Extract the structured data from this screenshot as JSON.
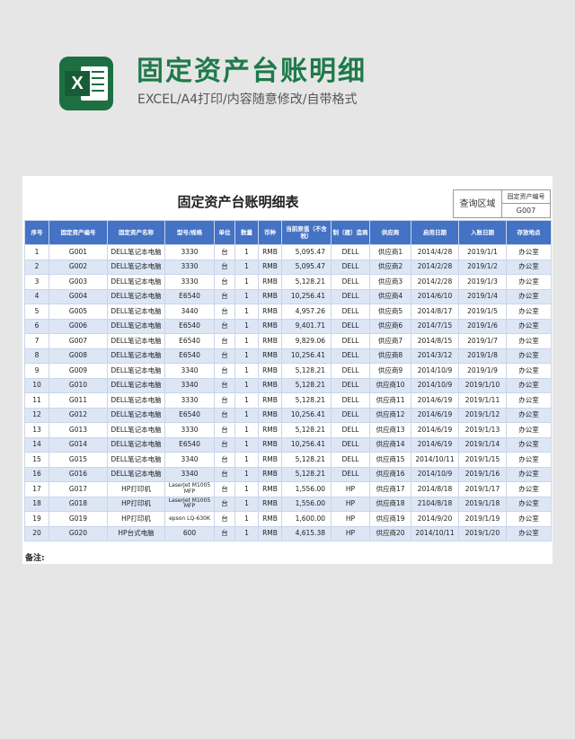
{
  "banner": {
    "icon": "excel-icon",
    "icon_letter": "X",
    "title": "固定资产台账明细",
    "subtitle": "EXCEL/A4打印/内容随意修改/自带格式"
  },
  "sheet": {
    "title": "固定资产台账明细表",
    "query_label": "查询区域",
    "query_key": "固定资产编号",
    "query_value": "G007",
    "remarks_label": "备注:"
  },
  "table": {
    "headers": [
      "序号",
      "固定资产编号",
      "固定资产名称",
      "型号/规格",
      "单位",
      "数量",
      "币种",
      "当前原值（不含税）",
      "制（建）造商",
      "供应商",
      "启用日期",
      "入账日期",
      "存放地点"
    ],
    "rows": [
      [
        "1",
        "G001",
        "DELL笔记本电脑",
        "3330",
        "台",
        "1",
        "RMB",
        "5,095.47",
        "DELL",
        "供应商1",
        "2014/4/28",
        "2019/1/1",
        "办公室"
      ],
      [
        "2",
        "G002",
        "DELL笔记本电脑",
        "3330",
        "台",
        "1",
        "RMB",
        "5,095.47",
        "DELL",
        "供应商2",
        "2014/2/28",
        "2019/1/2",
        "办公室"
      ],
      [
        "3",
        "G003",
        "DELL笔记本电脑",
        "3330",
        "台",
        "1",
        "RMB",
        "5,128.21",
        "DELL",
        "供应商3",
        "2014/2/28",
        "2019/1/3",
        "办公室"
      ],
      [
        "4",
        "G004",
        "DELL笔记本电脑",
        "E6540",
        "台",
        "1",
        "RMB",
        "10,256.41",
        "DELL",
        "供应商4",
        "2014/6/10",
        "2019/1/4",
        "办公室"
      ],
      [
        "5",
        "G005",
        "DELL笔记本电脑",
        "3440",
        "台",
        "1",
        "RMB",
        "4,957.26",
        "DELL",
        "供应商5",
        "2014/8/17",
        "2019/1/5",
        "办公室"
      ],
      [
        "6",
        "G006",
        "DELL笔记本电脑",
        "E6540",
        "台",
        "1",
        "RMB",
        "9,401.71",
        "DELL",
        "供应商6",
        "2014/7/15",
        "2019/1/6",
        "办公室"
      ],
      [
        "7",
        "G007",
        "DELL笔记本电脑",
        "E6540",
        "台",
        "1",
        "RMB",
        "9,829.06",
        "DELL",
        "供应商7",
        "2014/8/15",
        "2019/1/7",
        "办公室"
      ],
      [
        "8",
        "G008",
        "DELL笔记本电脑",
        "E6540",
        "台",
        "1",
        "RMB",
        "10,256.41",
        "DELL",
        "供应商8",
        "2014/3/12",
        "2019/1/8",
        "办公室"
      ],
      [
        "9",
        "G009",
        "DELL笔记本电脑",
        "3340",
        "台",
        "1",
        "RMB",
        "5,128.21",
        "DELL",
        "供应商9",
        "2014/10/9",
        "2019/1/9",
        "办公室"
      ],
      [
        "10",
        "G010",
        "DELL笔记本电脑",
        "3340",
        "台",
        "1",
        "RMB",
        "5,128.21",
        "DELL",
        "供应商10",
        "2014/10/9",
        "2019/1/10",
        "办公室"
      ],
      [
        "11",
        "G011",
        "DELL笔记本电脑",
        "3330",
        "台",
        "1",
        "RMB",
        "5,128.21",
        "DELL",
        "供应商11",
        "2014/6/19",
        "2019/1/11",
        "办公室"
      ],
      [
        "12",
        "G012",
        "DELL笔记本电脑",
        "E6540",
        "台",
        "1",
        "RMB",
        "10,256.41",
        "DELL",
        "供应商12",
        "2014/6/19",
        "2019/1/12",
        "办公室"
      ],
      [
        "13",
        "G013",
        "DELL笔记本电脑",
        "3330",
        "台",
        "1",
        "RMB",
        "5,128.21",
        "DELL",
        "供应商13",
        "2014/6/19",
        "2019/1/13",
        "办公室"
      ],
      [
        "14",
        "G014",
        "DELL笔记本电脑",
        "E6540",
        "台",
        "1",
        "RMB",
        "10,256.41",
        "DELL",
        "供应商14",
        "2014/6/19",
        "2019/1/14",
        "办公室"
      ],
      [
        "15",
        "G015",
        "DELL笔记本电脑",
        "3340",
        "台",
        "1",
        "RMB",
        "5,128.21",
        "DELL",
        "供应商15",
        "2014/10/11",
        "2019/1/15",
        "办公室"
      ],
      [
        "16",
        "G016",
        "DELL笔记本电脑",
        "3340",
        "台",
        "1",
        "RMB",
        "5,128.21",
        "DELL",
        "供应商16",
        "2014/10/9",
        "2019/1/16",
        "办公室"
      ],
      [
        "17",
        "G017",
        "HP打印机",
        "LaserJet M1005 MFP",
        "台",
        "1",
        "RMB",
        "1,556.00",
        "HP",
        "供应商17",
        "2014/8/18",
        "2019/1/17",
        "办公室"
      ],
      [
        "18",
        "G018",
        "HP打印机",
        "LaserJet M1005 MFP",
        "台",
        "1",
        "RMB",
        "1,556.00",
        "HP",
        "供应商18",
        "2104/8/18",
        "2019/1/18",
        "办公室"
      ],
      [
        "19",
        "G019",
        "HP打印机",
        "epson LQ-630K",
        "台",
        "1",
        "RMB",
        "1,600.00",
        "HP",
        "供应商19",
        "2014/9/20",
        "2019/1/19",
        "办公室"
      ],
      [
        "20",
        "G020",
        "HP台式电脑",
        "600",
        "台",
        "1",
        "RMB",
        "4,615.38",
        "HP",
        "供应商20",
        "2014/10/11",
        "2019/1/20",
        "办公室"
      ]
    ]
  },
  "colors": {
    "header_bg": "#4472c4",
    "row_stripe": "#dce6f5",
    "title_green": "#1e7a4a",
    "page_bg": "#e6e6e6"
  }
}
